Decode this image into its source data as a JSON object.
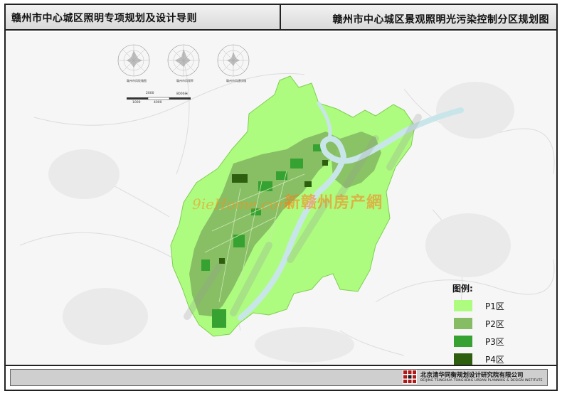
{
  "header": {
    "doc_title": "赣州市中心城区照明专项规划及设计导则",
    "map_title": "赣州市中心城区景观照明光污染控制分区规划图"
  },
  "map": {
    "watermark_text": "9ieHome.com",
    "watermark_brand": "新赣州房产網",
    "compass_captions": [
      "赣州市风玫瑰图",
      "赣州市风频率",
      "赣州市风速玫瑰"
    ],
    "scale_labels_top": [
      "2000",
      "8000米"
    ],
    "scale_labels_bottom": [
      "1000",
      "4000"
    ]
  },
  "legend": {
    "title": "图例:",
    "items": [
      {
        "label": "P1区",
        "color": "#adfc80"
      },
      {
        "label": "P2区",
        "color": "#86bc63"
      },
      {
        "label": "P3区",
        "color": "#36a232"
      },
      {
        "label": "P4区",
        "color": "#2d5f0f"
      }
    ]
  },
  "footer": {
    "institute_name": "北京清华同衡规划设计研究院有限公司",
    "institute_name_en": "BEIJING TSINGHUA TONGHENG URBAN PLANNING & DESIGN INSTITUTE"
  },
  "colors": {
    "p1": "#adfc80",
    "p2": "#86bc63",
    "p3": "#36a232",
    "p4": "#2d5f0f",
    "river": "#cfe7ea",
    "base_map": "#f4f4f4"
  }
}
